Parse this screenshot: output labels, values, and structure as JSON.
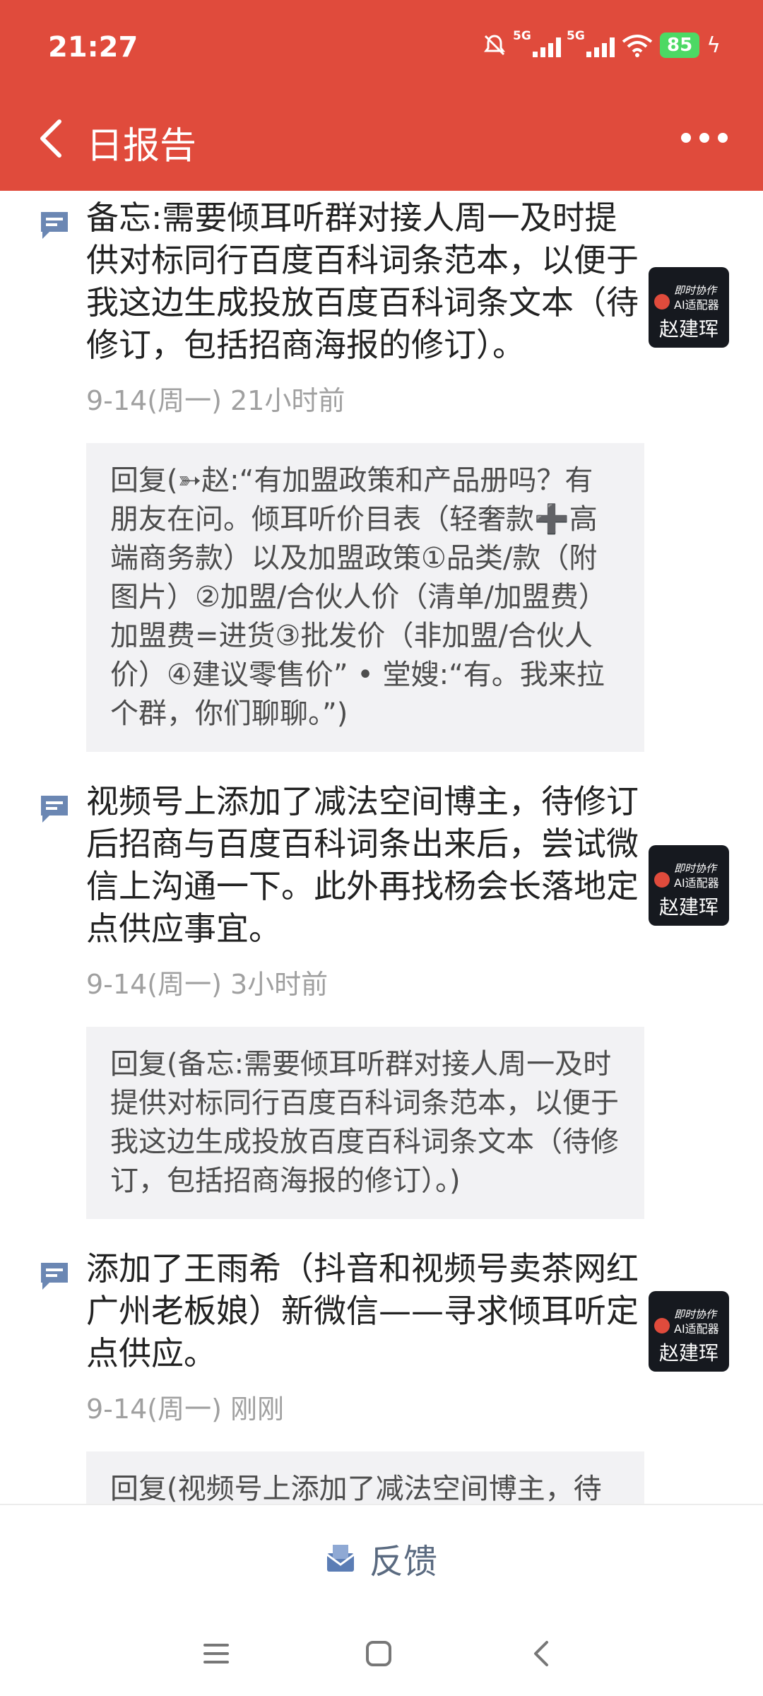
{
  "status": {
    "time": "21:27",
    "network1": "5G",
    "network2": "5G",
    "battery": "85"
  },
  "header": {
    "title": "日报告"
  },
  "entries": [
    {
      "text": "备忘:需要倾耳听群对接人周一及时提供对标同行百度百科词条范本，以便于我这边生成投放百度百科词条文本（待修订，包括招商海报的修订）。",
      "meta": "9-14(周一)  21小时前",
      "avatar": {
        "line1": "即时协作",
        "line2": "AI适配器",
        "name": "赵建珲"
      },
      "reply": "回复(➳赵:“有加盟政策和产品册吗？有朋友在问。倾耳听价目表（轻奢款➕高端商务款）以及加盟政策①品类/款（附图片）②加盟/合伙人价（清单/加盟费）加盟费=进货③批发价（非加盟/合伙人价）④建议零售价” • 堂嫂:“有。我来拉个群，你们聊聊。”)"
    },
    {
      "text": "视频号上添加了减法空间博主，待修订后招商与百度百科词条出来后，尝试微信上沟通一下。此外再找杨会长落地定点供应事宜。",
      "meta": "9-14(周一)  3小时前",
      "avatar": {
        "line1": "即时协作",
        "line2": "AI适配器",
        "name": "赵建珲"
      },
      "reply": "回复(备忘:需要倾耳听群对接人周一及时提供对标同行百度百科词条范本，以便于我这边生成投放百度百科词条文本（待修订，包括招商海报的修订）。)"
    },
    {
      "text": "添加了王雨希（抖音和视频号卖茶网红广州老板娘）新微信——寻求倾耳听定点供应。",
      "meta": "9-14(周一)  刚刚",
      "avatar": {
        "line1": "即时协作",
        "line2": "AI适配器",
        "name": "赵建珲"
      },
      "reply": "回复(视频号上添加了减法空间博主，待修订后招商与百度百科词条出来后，尝试微信上"
    }
  ],
  "footer": {
    "feedback_label": "反馈"
  },
  "colors": {
    "brand": "#e04b3c",
    "reply_bg": "#f2f2f4",
    "meta": "#a0a0a0"
  }
}
